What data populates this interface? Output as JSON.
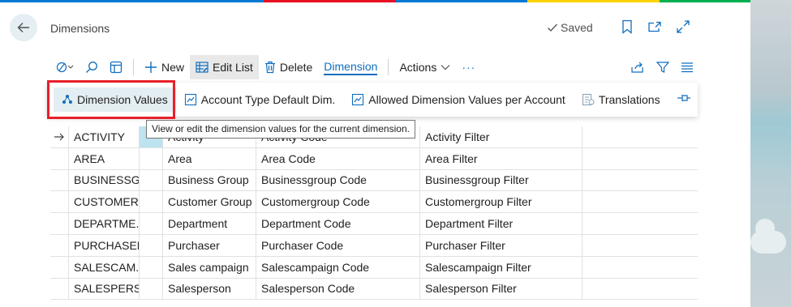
{
  "page": {
    "title": "Dimensions",
    "saved_label": "Saved"
  },
  "colors": {
    "accent": "#106ebe",
    "highlight_border": "#e8202a",
    "selected_cell": "#bde3ee",
    "subbar_active": "#e3eef2"
  },
  "header_icons": [
    "back-arrow-icon",
    "bookmark-icon",
    "open-in-new-icon",
    "expand-icon"
  ],
  "toolbar": {
    "new_label": "New",
    "edit_list_label": "Edit List",
    "delete_label": "Delete",
    "dimension_label": "Dimension",
    "actions_label": "Actions",
    "more_label": "···"
  },
  "subbar": {
    "dimension_values": "Dimension Values",
    "account_type_default": "Account Type Default Dim.",
    "allowed_values": "Allowed Dimension Values per Account",
    "translations": "Translations"
  },
  "tooltip": "View or edit the dimension values for the current dimension.",
  "rows": [
    {
      "code": "ACTIVITY",
      "name": "Activity",
      "code_caption": "Activity Code",
      "filter_caption": "Activity Filter"
    },
    {
      "code": "AREA",
      "name": "Area",
      "code_caption": "Area Code",
      "filter_caption": "Area Filter"
    },
    {
      "code": "BUSINESSG...",
      "name": "Business Group",
      "code_caption": "Businessgroup Code",
      "filter_caption": "Businessgroup Filter"
    },
    {
      "code": "CUSTOMER...",
      "name": "Customer Group",
      "code_caption": "Customergroup Code",
      "filter_caption": "Customergroup Filter"
    },
    {
      "code": "DEPARTME...",
      "name": "Department",
      "code_caption": "Department Code",
      "filter_caption": "Department Filter"
    },
    {
      "code": "PURCHASER",
      "name": "Purchaser",
      "code_caption": "Purchaser Code",
      "filter_caption": "Purchaser Filter"
    },
    {
      "code": "SALESCAM...",
      "name": "Sales campaign",
      "code_caption": "Salescampaign Code",
      "filter_caption": "Salescampaign Filter"
    },
    {
      "code": "SALESPERS...",
      "name": "Salesperson",
      "code_caption": "Salesperson Code",
      "filter_caption": "Salesperson Filter"
    }
  ]
}
